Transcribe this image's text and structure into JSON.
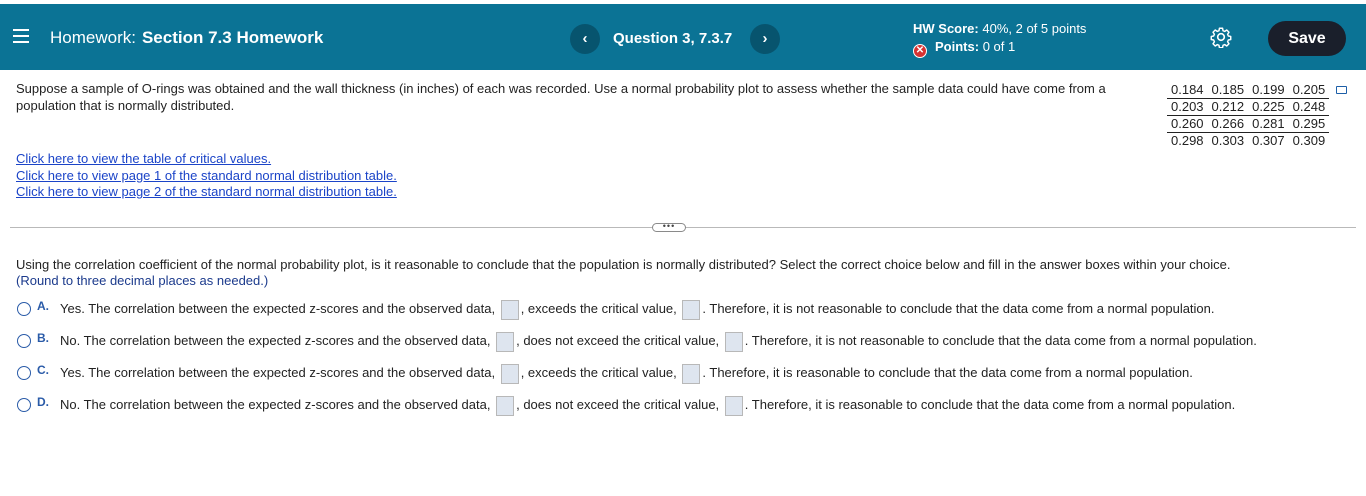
{
  "header": {
    "title_prefix": "Homework:",
    "title_name": "Section 7.3 Homework",
    "question_label": "Question 3, 7.3.7",
    "prev_label": "‹",
    "next_label": "›",
    "hw_score_label": "HW Score:",
    "hw_score_value": "40%, 2 of 5 points",
    "points_label": "Points:",
    "points_value": "0 of 1",
    "save_label": "Save",
    "colors": {
      "bar": "#0b7395",
      "save": "#1a1f2b",
      "incorrect": "#d63232"
    }
  },
  "problem": {
    "text": "Suppose a sample of O-rings was obtained and the wall thickness (in inches) of each was recorded. Use a normal probability plot to assess whether the sample data could have come from a population that is normally distributed.",
    "data_rows": [
      [
        "0.184",
        "0.185",
        "0.199",
        "0.205"
      ],
      [
        "0.203",
        "0.212",
        "0.225",
        "0.248"
      ],
      [
        "0.260",
        "0.266",
        "0.281",
        "0.295"
      ],
      [
        "0.298",
        "0.303",
        "0.307",
        "0.309"
      ]
    ],
    "links": [
      "Click here to view the table of critical values.",
      "Click here to view page 1 of the standard normal distribution table.",
      "Click here to view page 2 of the standard normal distribution table."
    ]
  },
  "question": {
    "text": "Using the correlation coefficient of the normal probability plot, is it reasonable to conclude that the population is normally distributed? Select the correct choice below and fill in the answer boxes within your choice.",
    "round_note": "(Round to three decimal places as needed.)",
    "choices": [
      {
        "letter": "A.",
        "part1": "Yes. The correlation between the expected z-scores and the observed data,",
        "part2": ", exceeds the critical value,",
        "part3": ". Therefore, it is not reasonable to conclude that the data come from a normal population."
      },
      {
        "letter": "B.",
        "part1": "No. The correlation between the expected z-scores and the observed data,",
        "part2": ", does not exceed the critical value,",
        "part3": ". Therefore, it is not reasonable to conclude that the data come from a normal population."
      },
      {
        "letter": "C.",
        "part1": "Yes. The correlation between the expected z-scores and the observed data,",
        "part2": ", exceeds the critical value,",
        "part3": ". Therefore, it is reasonable to conclude that the data come from a normal population."
      },
      {
        "letter": "D.",
        "part1": "No. The correlation between the expected z-scores and the observed data,",
        "part2": ", does not exceed the critical value,",
        "part3": ". Therefore, it is reasonable to conclude that the data come from a normal population."
      }
    ]
  }
}
